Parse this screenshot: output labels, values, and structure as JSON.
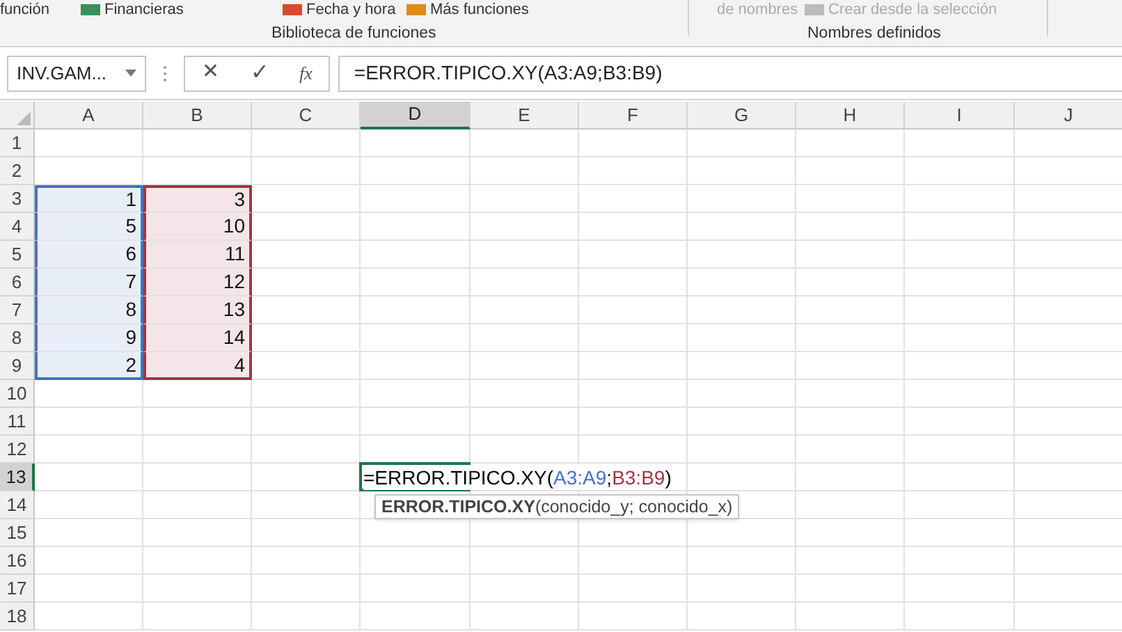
{
  "ribbon": {
    "items": [
      {
        "text": "función"
      },
      {
        "text": "Financieras"
      },
      {
        "text": "Fecha y hora"
      },
      {
        "text": "Más funciones"
      },
      {
        "text": "de nombres"
      },
      {
        "text": "Crear desde la selección"
      }
    ],
    "groups": [
      "Biblioteca de funciones",
      "Nombres definidos"
    ]
  },
  "formula_bar": {
    "name_box": "INV.GAM...",
    "cancel": "✕",
    "enter": "✓",
    "function_label": "fx",
    "formula": "=ERROR.TIPICO.XY(A3:A9;B3:B9)"
  },
  "columns": [
    {
      "label": "A",
      "selected": false
    },
    {
      "label": "B",
      "selected": false
    },
    {
      "label": "C",
      "selected": false
    },
    {
      "label": "D",
      "selected": true
    },
    {
      "label": "E",
      "selected": false
    },
    {
      "label": "F",
      "selected": false
    },
    {
      "label": "G",
      "selected": false
    },
    {
      "label": "H",
      "selected": false
    },
    {
      "label": "I",
      "selected": false
    },
    {
      "label": "J",
      "selected": false
    }
  ],
  "rows": [
    {
      "label": "1",
      "selected": false,
      "cells": []
    },
    {
      "label": "2",
      "selected": false,
      "cells": []
    },
    {
      "label": "3",
      "selected": false,
      "cells": [
        {
          "text": "1",
          "color": "#4472c4"
        },
        {
          "text": "3",
          "color": "#a5343f"
        }
      ]
    },
    {
      "label": "4",
      "selected": false,
      "cells": [
        {
          "text": "5",
          "color": "#4472c4"
        },
        {
          "text": "10",
          "color": "#a5343f"
        }
      ]
    },
    {
      "label": "5",
      "selected": false,
      "cells": [
        {
          "text": "6",
          "color": "#4472c4"
        },
        {
          "text": "11",
          "color": "#a5343f"
        }
      ]
    },
    {
      "label": "6",
      "selected": false,
      "cells": [
        {
          "text": "7",
          "color": "#4472c4"
        },
        {
          "text": "12",
          "color": "#a5343f"
        }
      ]
    },
    {
      "label": "7",
      "selected": false,
      "cells": [
        {
          "text": "8",
          "color": "#4472c4"
        },
        {
          "text": "13",
          "color": "#a5343f"
        }
      ]
    },
    {
      "label": "8",
      "selected": false,
      "cells": [
        {
          "text": "9",
          "color": "#4472c4"
        },
        {
          "text": "14",
          "color": "#a5343f"
        }
      ]
    },
    {
      "label": "9",
      "selected": false,
      "cells": [
        {
          "text": "2",
          "color": "#4472c4"
        },
        {
          "text": "4",
          "color": "#a5343f"
        }
      ]
    },
    {
      "label": "10",
      "selected": false,
      "cells": []
    },
    {
      "label": "11",
      "selected": false,
      "cells": []
    },
    {
      "label": "12",
      "selected": false,
      "cells": []
    },
    {
      "label": "13",
      "selected": true,
      "cells": []
    },
    {
      "label": "14",
      "selected": false,
      "cells": []
    },
    {
      "label": "15",
      "selected": false,
      "cells": []
    },
    {
      "label": "16",
      "selected": false,
      "cells": []
    },
    {
      "label": "17",
      "selected": false,
      "cells": []
    },
    {
      "label": "18",
      "selected": false,
      "cells": []
    }
  ],
  "editing_cell": {
    "parts": [
      {
        "text": "=ERROR.TIPICO.XY(",
        "color": "#000000"
      },
      {
        "text": "A3:A9",
        "color": "#4472c4"
      },
      {
        "text": ";",
        "color": "#000000"
      },
      {
        "text": "B3:B9",
        "color": "#a5343f"
      },
      {
        "text": ")",
        "color": "#000000"
      }
    ],
    "tooltip": "**ERROR.TIPICO.XY**(conocido_y; conocido_x)"
  }
}
